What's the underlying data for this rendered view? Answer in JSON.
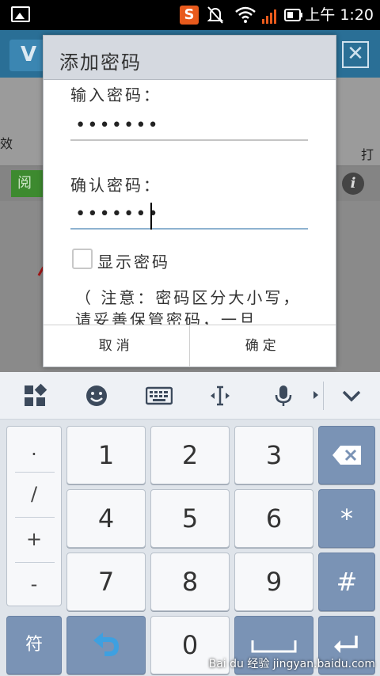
{
  "status_bar": {
    "time": "上午 1:20",
    "app_badge": "S"
  },
  "background_app": {
    "title_initial": "V",
    "left_tool_label": "效",
    "right_tool_label": "打",
    "green_button_label": "阅",
    "info_glyph": "i"
  },
  "dialog": {
    "title": "添加密码",
    "password_label": "输入密码：",
    "password_value": "•••••••",
    "confirm_label": "确认密码：",
    "confirm_value": "•••••••",
    "show_password_label": "显示密码",
    "note_text": "（ 注意：密码区分大小写，请妥善保管密码，一旦",
    "cancel_label": "取消",
    "ok_label": "确定"
  },
  "keyboard": {
    "symbols": [
      ".",
      "/",
      "+",
      "-"
    ],
    "digits": [
      "1",
      "2",
      "3",
      "4",
      "5",
      "6",
      "7",
      "8",
      "9",
      "0"
    ],
    "star": "*",
    "hash": "#",
    "symbol_key": "符"
  },
  "watermark": "Bai du 经验 jingyan.baidu.com",
  "colors": {
    "accent": "#7a93b5",
    "dialog_title_bg": "#d5d9e0",
    "app_blue": "#2a6f96"
  }
}
